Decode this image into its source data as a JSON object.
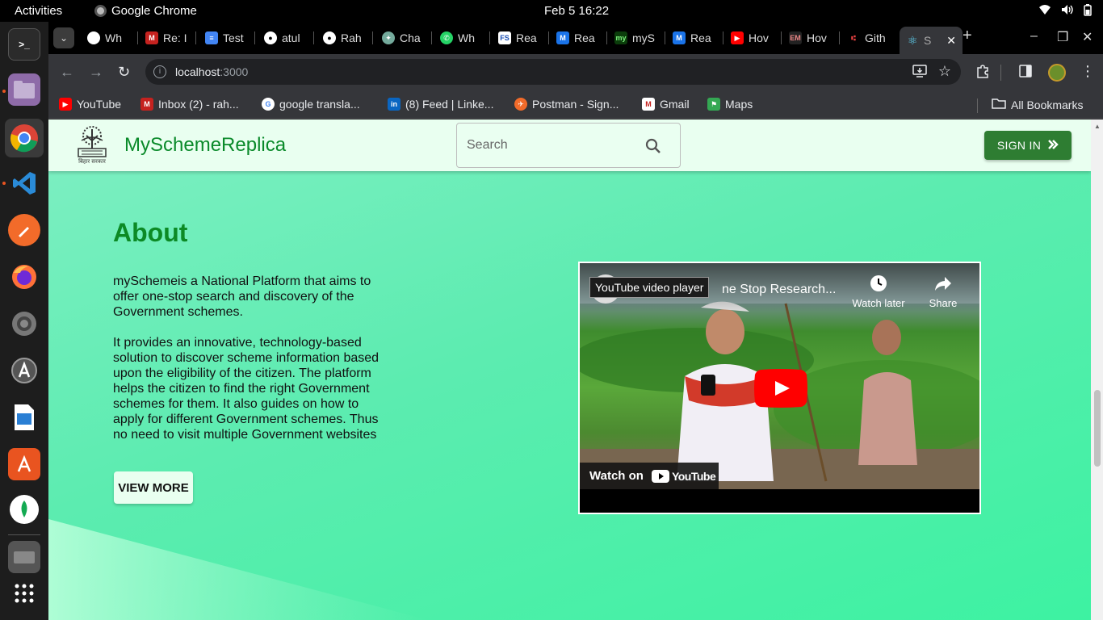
{
  "system": {
    "activities": "Activities",
    "app_name": "Google Chrome",
    "clock": "Feb 5  16:22"
  },
  "browser": {
    "tabs": [
      "Wh",
      "Re: I",
      "Test",
      "atul",
      "Rah",
      "Cha",
      "Wh",
      "Rea",
      "Rea",
      "myS",
      "Rea",
      "Hov",
      "Hov",
      "Gith",
      "S"
    ],
    "url_host": "localhost",
    "url_port": ":3000",
    "bookmarks": [
      "YouTube",
      "Inbox (2) - rah...",
      "google transla...",
      "(8) Feed | Linke...",
      "Postman - Sign...",
      "Gmail",
      "Maps"
    ],
    "all_bookmarks": "All Bookmarks"
  },
  "site": {
    "title": "MySchemeReplica",
    "search_placeholder": "Search",
    "signin_label": "SIGN IN",
    "logo_caption": "बिहार सरकार"
  },
  "about": {
    "heading": "About",
    "para1": "mySchemeis a National Platform that aims to offer one-stop search and discovery of the Government schemes.",
    "para2": "It provides an innovative, technology-based solution to discover scheme information based upon the eligibility of the citizen. The platform helps the citizen to find the right Government schemes for them. It also guides on how to apply for different Government schemes. Thus no need to visit multiple Government websites",
    "view_more": "VIEW MORE"
  },
  "video": {
    "tooltip": "YouTube video player",
    "title": "ne Stop Research...",
    "watch_later": "Watch later",
    "share": "Share",
    "watch_on": "Watch on",
    "youtube": "YouTube"
  },
  "colors": {
    "brand_green": "#0a8a2a",
    "signin_bg": "#2e7d32",
    "header_bg": "#e9fff0",
    "page_gradient_end": "#3df2a2"
  }
}
